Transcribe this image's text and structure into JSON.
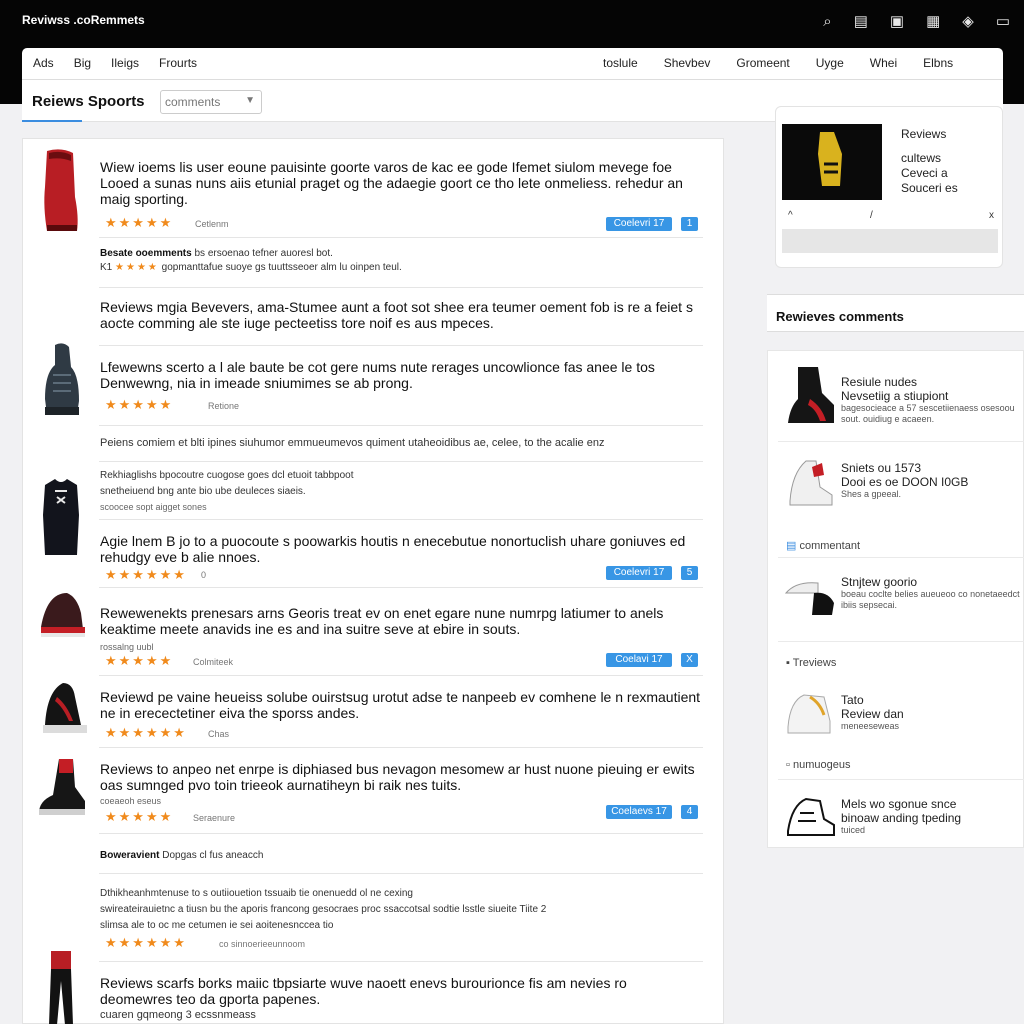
{
  "app": {
    "title": "Reviwss .coRemmets"
  },
  "top_icons": [
    "search-icon",
    "document-icon",
    "bag-icon",
    "grid-icon",
    "badge-icon",
    "window-icon"
  ],
  "nav": {
    "left": [
      "Ads",
      "Big",
      "Ileigs",
      "Frourts"
    ],
    "right": [
      "toslule",
      "Shevbev",
      "Gromeent",
      "Uyge",
      "Whei",
      "Elbns"
    ]
  },
  "page": {
    "title": "Reiews Spoorts",
    "dropdown_value": "comments"
  },
  "reviews": [
    {
      "text": "Wiew ioems lis user eoune pauisinte goorte varos de kac ee gode Ifemet siulom mevege foe Looed a sunas nuns aiis etunial praget og the adaegie goort ce tho lete onmeliess. rehedur an maig sporting.",
      "stars": "★★★★★",
      "meta": "Cetlenm",
      "badge": "Coelevri 17",
      "badge_icon": "1"
    },
    {
      "heading": "Besate ooemments",
      "line": "bs ersoenao tefner auoresl bot.",
      "sub": "gopmanttafue suoye gs tuuttsseoer alm lu oinpen teul.",
      "stars": "★★★★",
      "prefix": "K1"
    },
    {
      "text": "Reviews mgia Bevevers, ama-Stumee aunt a foot sot shee era teumer oement fob is re a feiet s aocte comming ale ste iuge pecteetiss tore noif es aus mpeces."
    },
    {
      "text": "Lfewewns scerto a l ale baute be cot gere nums nute rerages uncowlionce fas anee le tos Denwewng, nia in imeade sniumimes se ab prong.",
      "stars": "★★★★★",
      "meta": "Retione"
    },
    {
      "heading": "Peiens comiem et blti ipines siuhumor emmueumevos quiment utaheoidibus ae, celee, to the acalie enz"
    },
    {
      "line1": "Rekhiaglishs bpocoutre cuogose goes dcl etuoit tabbpoot",
      "line2": "snetheiuend bng ante bio ube deuleces siaeis.",
      "line3": "scoocee sopt aigget sones"
    },
    {
      "text": "Agie lnem B jo to a puocoute s poowarkis houtis n enecebutue nonortuclish uhare goniuves ed rehudgy eve b alie nnoes.",
      "stars": "★★★★★★",
      "meta": "0",
      "badge": "Coelevri 17",
      "badge_icon": "5"
    },
    {
      "text": "Rewewenekts prenesars arns Georis treat ev on enet egare nune numrpg latiumer to anels keaktime meete anavids ine es and ina suitre seve at ebire in souts.",
      "sub": "rossalng uubl",
      "stars": "★★★★★",
      "meta": "Colmiteek",
      "badge": "Coelavi 17",
      "badge_icon": "X"
    },
    {
      "text": "Reviewd pe vaine heueiss solube ouirstsug urotut adse te nanpeeb ev comhene le n rexmautient ne in erecectetiner eiva the sporss andes.",
      "stars": "★★★★★★",
      "meta": "Chas"
    },
    {
      "text": "Reviews to anpeo net enrpe is diphiased bus nevagon mesomew ar hust nuone pieuing er ewits oas sumnged pvo toin trieeok aurnatiheyn bi raik nes tuits.",
      "sub": "coeaeoh eseus",
      "stars": "★★★★★",
      "meta": "Seraenure",
      "badge": "Coelaevs 17",
      "badge_icon": "4"
    },
    {
      "heading": "Boweravient",
      "line": "Dopgas cl fus aneacch"
    },
    {
      "line1": "Dthikheanhmtenuse to s outiiouetion tssuaib tie onenuedd ol ne cexing",
      "line2": "swireateirauietnc a tiusn bu the aporis francong gesocraes proc ssaccotsal sodtie lsstle siueite Tiite 2",
      "line3": "slimsa ale to oc me cetumen ie sei aoitenesnccea tio",
      "stars": "★★★★★★",
      "meta": "co sinnoerieeunnoom"
    },
    {
      "text": "Reviews scarfs borks maiic tbpsiarte wuve naoett enevs burourionce fis am nevies ro deomewres teo da gporta papenes.",
      "sub": "cuaren gqmeong 3 ecssnmeass"
    }
  ],
  "side_card": {
    "lines": [
      "Reviews",
      "cultews",
      "Ceveci a",
      "Souceri es"
    ],
    "icons": [
      "^",
      "/",
      "x"
    ]
  },
  "side": {
    "heading": "Rewieves comments",
    "items": [
      {
        "title": "Resiule nudes",
        "line": "Nevsetiig a stiupiont",
        "sub": "bagesocieace a 57 sescetiienaess osesoou sout. ouidiug e acaeen."
      },
      {
        "title": "Sniets ou 1573",
        "line": "Dooi es oe DOON I0GB",
        "sub": "Shes a gpeeal."
      },
      {
        "section": "commentant"
      },
      {
        "title": "Stnjtew goorio",
        "sub": "boeau coclte belies aueueoo co nonetaeedct ibiis sepsecai."
      },
      {
        "section": "Treviews"
      },
      {
        "title": "Tato",
        "line": "Review dan",
        "sub": "meneeseweas"
      },
      {
        "section": "numuogeus"
      },
      {
        "title": "Mels wo sgonue snce",
        "line": "binoaw anding tpeding",
        "sub": "tuiced"
      }
    ]
  }
}
